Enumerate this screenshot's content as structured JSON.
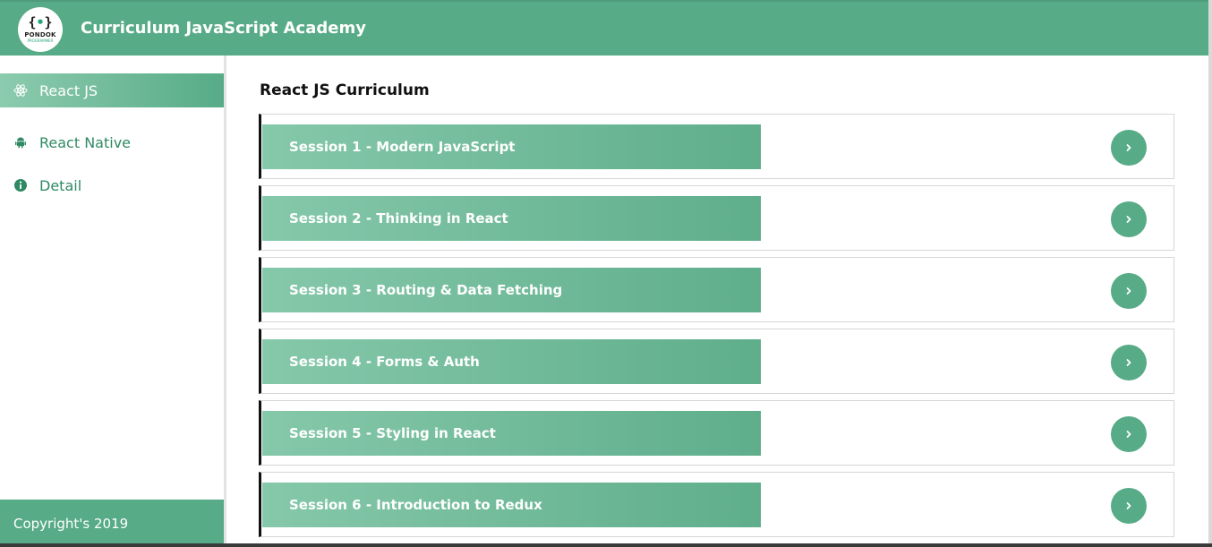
{
  "header": {
    "title": "Curriculum JavaScript Academy",
    "logo_text": "PONDOK",
    "logo_subtext": "PROGRAMMER"
  },
  "sidebar": {
    "items": [
      {
        "label": "React JS",
        "icon": "atom-icon",
        "active": true
      },
      {
        "label": "React Native",
        "icon": "android-icon",
        "active": false
      },
      {
        "label": "Detail",
        "icon": "info-icon",
        "active": false
      }
    ],
    "footer": "Copyright's 2019"
  },
  "main": {
    "title": "React JS Curriculum",
    "sessions": [
      {
        "label": "Session 1 - Modern JavaScript"
      },
      {
        "label": "Session 2 - Thinking in React"
      },
      {
        "label": "Session 3 - Routing & Data Fetching"
      },
      {
        "label": "Session 4 - Forms & Auth"
      },
      {
        "label": "Session 5 - Styling in React"
      },
      {
        "label": "Session 6 - Introduction to Redux"
      }
    ]
  },
  "colors": {
    "primary": "#57ab87",
    "primary_light": "#8ccbae",
    "text_green": "#2f8a64"
  }
}
